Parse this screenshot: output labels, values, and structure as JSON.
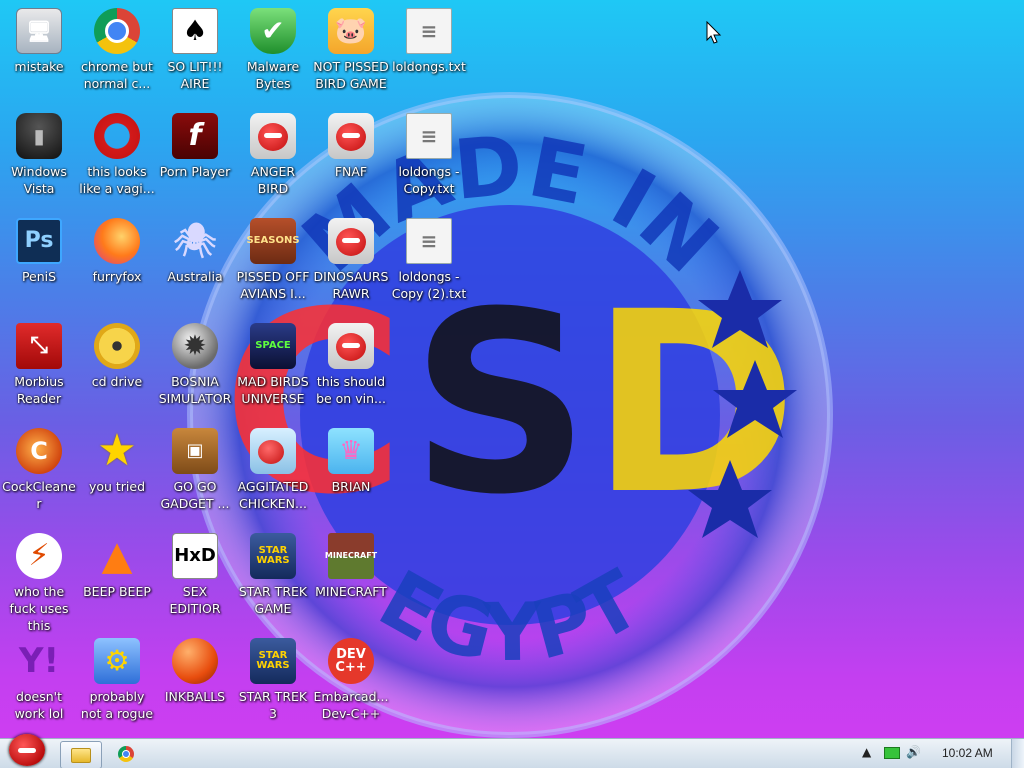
{
  "desktop": {
    "wallpaper": {
      "seal_text_top": "MADE IN",
      "seal_text_bottom": "EGYPT",
      "seal_letters": "CSD",
      "colors": {
        "c_letter": "#ff2f2f",
        "s_letter": "#111111",
        "d_letter": "#ffd900",
        "ring": "#1b46b8"
      }
    },
    "icons": [
      {
        "label": "mistake",
        "icon": "monitor-icon"
      },
      {
        "label": "chrome but normal c...",
        "icon": "chrome-icon"
      },
      {
        "label": "SO LIT!!! AIRE",
        "icon": "solitaire-cards-icon"
      },
      {
        "label": "Malware Bytes",
        "icon": "shield-icon"
      },
      {
        "label": "NOT PISSED BIRD GAME",
        "icon": "pig-icon"
      },
      {
        "label": "loldongs.txt",
        "icon": "text-file-icon"
      },
      {
        "label": "Windows Vista",
        "icon": "recycle-bin-icon"
      },
      {
        "label": "this looks like a vagi...",
        "icon": "opera-icon"
      },
      {
        "label": "Porn Player",
        "icon": "flash-icon"
      },
      {
        "label": "ANGER BIRD",
        "icon": "angry-bird-icon"
      },
      {
        "label": "FNAF",
        "icon": "angry-bird-icon"
      },
      {
        "label": "loldongs - Copy.txt",
        "icon": "text-file-icon"
      },
      {
        "label": "PeniS",
        "icon": "photoshop-icon"
      },
      {
        "label": "furryfox",
        "icon": "firefox-icon"
      },
      {
        "label": "Australia",
        "icon": "spider-solitaire-icon"
      },
      {
        "label": "PISSED OFF AVIANS I...",
        "icon": "angry-birds-seasons-icon"
      },
      {
        "label": "DINOSAURS RAWR",
        "icon": "angry-bird-icon"
      },
      {
        "label": "loldongs - Copy (2).txt",
        "icon": "text-file-icon"
      },
      {
        "label": "Morbius Reader",
        "icon": "pdf-reader-icon"
      },
      {
        "label": "cd drive",
        "icon": "cd-drive-icon"
      },
      {
        "label": "BOSNIA SIMULATOR",
        "icon": "minesweeper-icon"
      },
      {
        "label": "MAD BIRDS UNIVERSE",
        "icon": "angry-birds-space-icon"
      },
      {
        "label": "this should be on vin...",
        "icon": "angry-bird-icon"
      },
      {
        "label": "CockCleaner",
        "icon": "ccleaner-icon"
      },
      {
        "label": "you tried",
        "icon": "star-icon"
      },
      {
        "label": "GO GO GADGET ...",
        "icon": "briefcase-icon"
      },
      {
        "label": "AGGITATED CHICKEN...",
        "icon": "angry-bird-chicken-icon"
      },
      {
        "label": "BRIAN",
        "icon": "bird-slingshot-icon"
      },
      {
        "label": "who the fuck uses this",
        "icon": "lightning-icon"
      },
      {
        "label": "BEEP BEEP",
        "icon": "vlc-cone-icon"
      },
      {
        "label": "SEX EDITIOR",
        "icon": "hxd-icon"
      },
      {
        "label": "STAR TREK GAME",
        "icon": "star-wars-icon"
      },
      {
        "label": "MINECRAFT",
        "icon": "minecraft-icon"
      },
      {
        "label": "doesn't work lol",
        "icon": "yahoo-messenger-icon"
      },
      {
        "label": "probably not a rogue",
        "icon": "gears-icon"
      },
      {
        "label": "INKBALLS",
        "icon": "inkball-icon"
      },
      {
        "label": "STAR TREK 3",
        "icon": "star-wars-icon"
      },
      {
        "label": "Embarcad... Dev-C++",
        "icon": "dev-cpp-icon"
      }
    ]
  },
  "taskbar": {
    "start": {
      "icon": "angry-bird-start-icon"
    },
    "pinned": [
      {
        "name": "explorer",
        "icon": "folder-icon"
      },
      {
        "name": "chrome",
        "icon": "chrome-icon"
      }
    ],
    "tray": {
      "arrow": "▲",
      "network_icon": "network-icon",
      "volume_icon": "volume-icon",
      "clock": "10:02 AM"
    }
  }
}
